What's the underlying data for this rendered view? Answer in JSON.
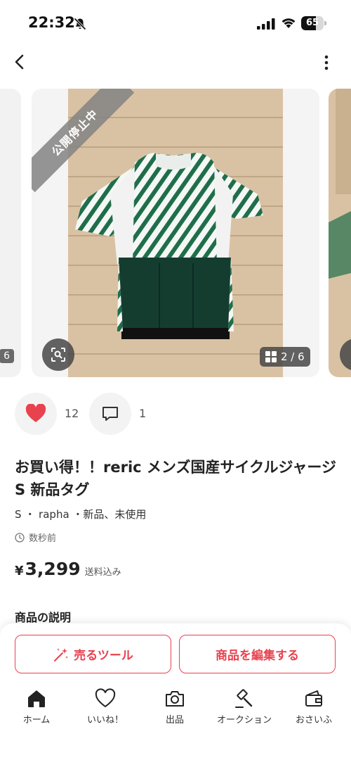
{
  "status_bar": {
    "time": "22:32",
    "battery": "65",
    "battery_level": 0.65
  },
  "carousel": {
    "prev_counter_fragment": "6",
    "ribbon_text": "公開停止中",
    "counter_text": "2 / 6"
  },
  "engagement": {
    "like_count": "12",
    "comment_count": "1"
  },
  "item": {
    "title": "お買い得！！reric メンズ国産サイクルジャージ S 新品タグ",
    "attributes": "S ・ rapha ・新品、未使用",
    "posted": "数秒前",
    "price_symbol": "¥",
    "price": "3,299",
    "price_note": "送料込み",
    "description_heading": "商品の説明"
  },
  "actions": {
    "sell_tool_label": "売るツール",
    "edit_label": "商品を編集する"
  },
  "tabs": {
    "home": "ホーム",
    "likes": "いいね！",
    "sell": "出品",
    "auction": "オークション",
    "wallet": "おさいふ"
  },
  "colors": {
    "accent": "#e8424f",
    "heart": "#e8424f",
    "jersey_green": "#1f6e4a",
    "floor": "#d9c2a3"
  }
}
